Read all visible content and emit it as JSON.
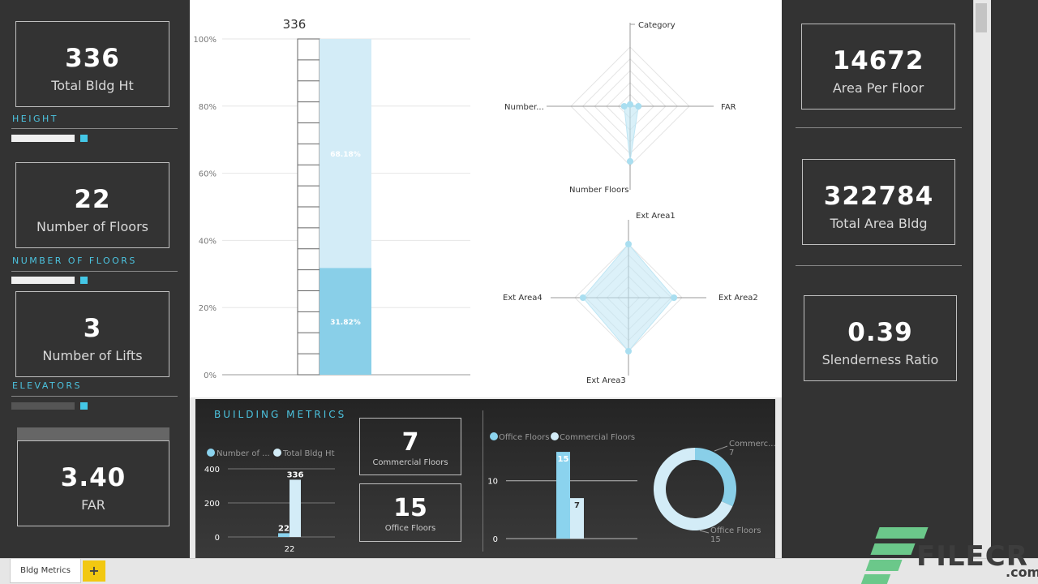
{
  "left_panel": {
    "kpis": [
      {
        "value": "336",
        "label": "Total Bldg Ht"
      },
      {
        "value": "22",
        "label": "Number of Floors"
      },
      {
        "value": "3",
        "label": "Number of Lifts"
      },
      {
        "value": "3.40",
        "label": "FAR"
      }
    ],
    "slicers": [
      {
        "title": "Height"
      },
      {
        "title": "Number of Floors"
      },
      {
        "title": "Elevators"
      }
    ]
  },
  "right_panel": {
    "kpis": [
      {
        "value": "14672",
        "label": "Area Per Floor"
      },
      {
        "value": "322784",
        "label": "Total Area Bldg"
      },
      {
        "value": "0.39",
        "label": "Slenderness Ratio"
      }
    ]
  },
  "stacked_chart": {
    "top_label": "336",
    "y_ticks": [
      "100%",
      "80%",
      "60%",
      "40%",
      "20%",
      "0%"
    ],
    "chart_data": {
      "type": "bar",
      "stacked": true,
      "ylim": [
        0,
        100
      ],
      "segments": [
        {
          "value": 31.82,
          "label": "31.82%",
          "color": "#89cfe8"
        },
        {
          "value": 68.18,
          "label": "68.18%",
          "color": "#d3ecf7"
        }
      ]
    }
  },
  "radar_top": {
    "labels": {
      "top": "Category",
      "right": "FAR",
      "bottom": "Number Floors",
      "left": "Number..."
    }
  },
  "radar_bottom": {
    "labels": {
      "top": "Ext Area1",
      "right": "Ext Area2",
      "bottom": "Ext Area3",
      "left": "Ext Area4"
    }
  },
  "building_metrics": {
    "title": "Building Metrics",
    "mini_chart": {
      "legend": [
        {
          "name": "Number of ...",
          "color": "#8bd3ee"
        },
        {
          "name": "Total Bldg Ht",
          "color": "#d3ecf7"
        }
      ],
      "y_ticks": [
        "400",
        "200",
        "0"
      ],
      "x_label": "22",
      "chart_data": {
        "type": "bar",
        "ylim": [
          0,
          400
        ],
        "series": [
          {
            "name": "Number of ...",
            "values": [
              22
            ],
            "label": "22",
            "color": "#8bd3ee"
          },
          {
            "name": "Total Bldg Ht",
            "values": [
              336
            ],
            "label": "336",
            "color": "#d3ecf7"
          }
        ]
      }
    },
    "cards": [
      {
        "value": "7",
        "label": "Commercial Floors"
      },
      {
        "value": "15",
        "label": "Office Floors"
      }
    ],
    "floors_chart": {
      "legend": [
        {
          "name": "Office Floors",
          "color": "#8bd3ee"
        },
        {
          "name": "Commercial Floors",
          "color": "#d3ecf7"
        }
      ],
      "y_ticks": [
        "10",
        "0"
      ],
      "chart_data": {
        "type": "bar",
        "ylim": [
          0,
          15
        ],
        "series": [
          {
            "name": "Office Floors",
            "values": [
              15
            ],
            "label": "15",
            "color": "#8bd3ee"
          },
          {
            "name": "Commercial Floors",
            "values": [
              7
            ],
            "label": "7",
            "color": "#d3ecf7"
          }
        ]
      }
    },
    "donut": {
      "labels": [
        {
          "name": "Commerc...",
          "value": "7"
        },
        {
          "name": "Office Floors",
          "value": "15"
        }
      ],
      "chart_data": {
        "type": "pie",
        "slices": [
          {
            "name": "Commercial Floors",
            "value": 7,
            "color": "#89cfe8"
          },
          {
            "name": "Office Floors",
            "value": 15,
            "color": "#d3ecf7"
          }
        ]
      }
    }
  },
  "tabs": {
    "active": "Bldg Metrics",
    "add": "+"
  },
  "watermark": {
    "brand": "FILECR",
    "domain": ".com"
  }
}
